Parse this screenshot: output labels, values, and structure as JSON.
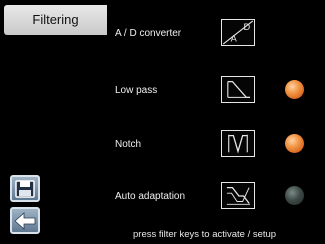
{
  "sidebar": {
    "active_tab": "Filtering",
    "save_icon": "floppy-disk-icon",
    "back_icon": "arrow-left-icon"
  },
  "rows": [
    {
      "label": "A / D converter",
      "icon": "ad-converter-icon",
      "status": null
    },
    {
      "label": "Low pass",
      "icon": "low-pass-icon",
      "status": "on"
    },
    {
      "label": "Notch",
      "icon": "notch-filter-icon",
      "status": "on"
    },
    {
      "label": "Auto adaptation",
      "icon": "auto-adaptation-icon",
      "status": "off"
    }
  ],
  "footer": {
    "hint": "press filter keys to activate / setup"
  },
  "colors": {
    "led_on": "#f0913f",
    "led_off": "#38433f"
  }
}
